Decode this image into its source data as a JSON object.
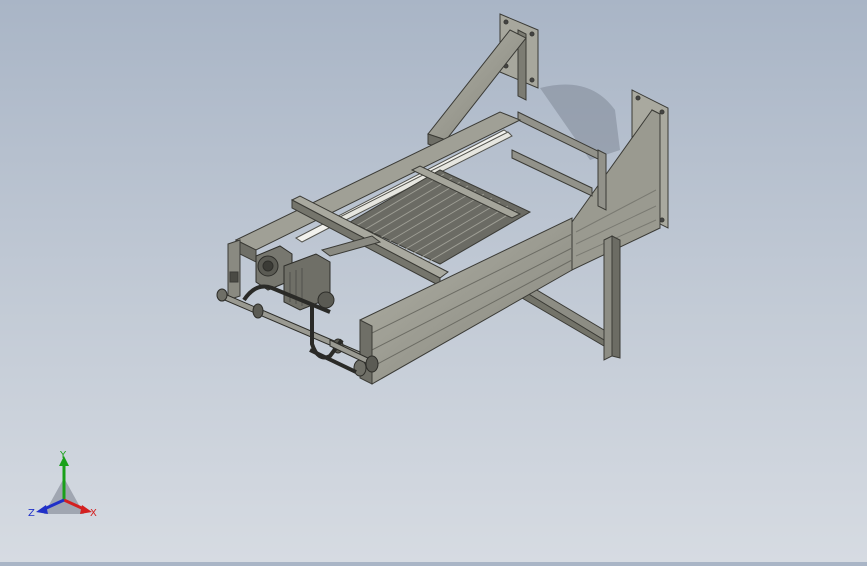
{
  "triad": {
    "x_label": "X",
    "y_label": "Y",
    "z_label": "Z",
    "x_color": "#d42020",
    "y_color": "#19a019",
    "z_color": "#2030c8"
  },
  "model": {
    "frame_color": "#8f8f86",
    "frame_dark": "#5c5c55",
    "frame_light": "#b5b5ab",
    "belt_color": "#3a3a36"
  }
}
